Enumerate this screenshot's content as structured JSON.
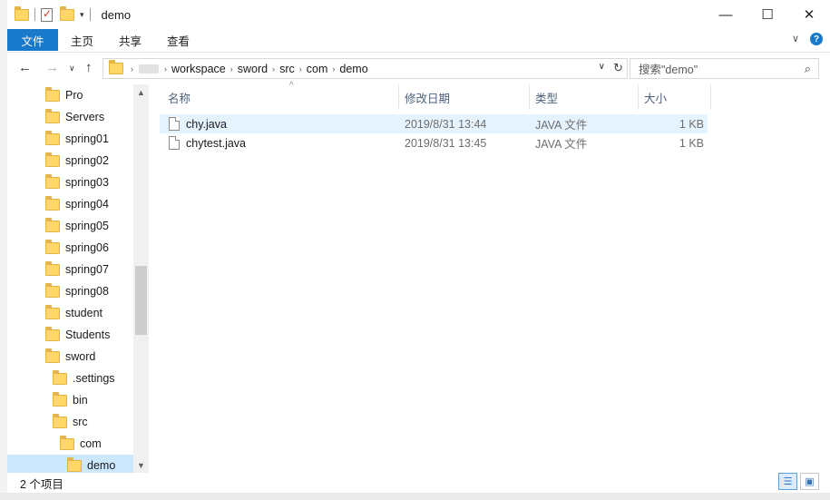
{
  "window": {
    "title": "demo",
    "controls": [
      "—",
      "☐",
      "✕"
    ]
  },
  "ribbon": {
    "tabs": [
      "文件",
      "主页",
      "共享",
      "查看"
    ],
    "expand_icon": "chevron-down-icon",
    "help_icon": "?"
  },
  "address": {
    "segments": [
      "workspace",
      "sword",
      "src",
      "com",
      "demo"
    ],
    "search_placeholder": "搜索\"demo\""
  },
  "sidebar": {
    "items": [
      {
        "label": "Pro",
        "indent": 0
      },
      {
        "label": "Servers",
        "indent": 0
      },
      {
        "label": "spring01",
        "indent": 0
      },
      {
        "label": "spring02",
        "indent": 0
      },
      {
        "label": "spring03",
        "indent": 0
      },
      {
        "label": "spring04",
        "indent": 0
      },
      {
        "label": "spring05",
        "indent": 0
      },
      {
        "label": "spring06",
        "indent": 0
      },
      {
        "label": "spring07",
        "indent": 0
      },
      {
        "label": "spring08",
        "indent": 0
      },
      {
        "label": "student",
        "indent": 0
      },
      {
        "label": "Students",
        "indent": 0
      },
      {
        "label": "sword",
        "indent": 0
      },
      {
        "label": ".settings",
        "indent": 1
      },
      {
        "label": "bin",
        "indent": 1
      },
      {
        "label": "src",
        "indent": 1
      },
      {
        "label": "com",
        "indent": 2
      },
      {
        "label": "demo",
        "indent": 3,
        "selected": true
      }
    ]
  },
  "columns": {
    "name": "名称",
    "modified": "修改日期",
    "type": "类型",
    "size": "大小"
  },
  "files": [
    {
      "name": "chy.java",
      "modified": "2019/8/31 13:44",
      "type": "JAVA 文件",
      "size": "1 KB",
      "hover": true
    },
    {
      "name": "chytest.java",
      "modified": "2019/8/31 13:45",
      "type": "JAVA 文件",
      "size": "1 KB",
      "hover": false
    }
  ],
  "status": {
    "item_count": "2 个项目"
  },
  "colors": {
    "accent": "#1979ca",
    "selection": "#cce8ff",
    "hover": "#e5f3ff",
    "folder": "#ffd767"
  }
}
